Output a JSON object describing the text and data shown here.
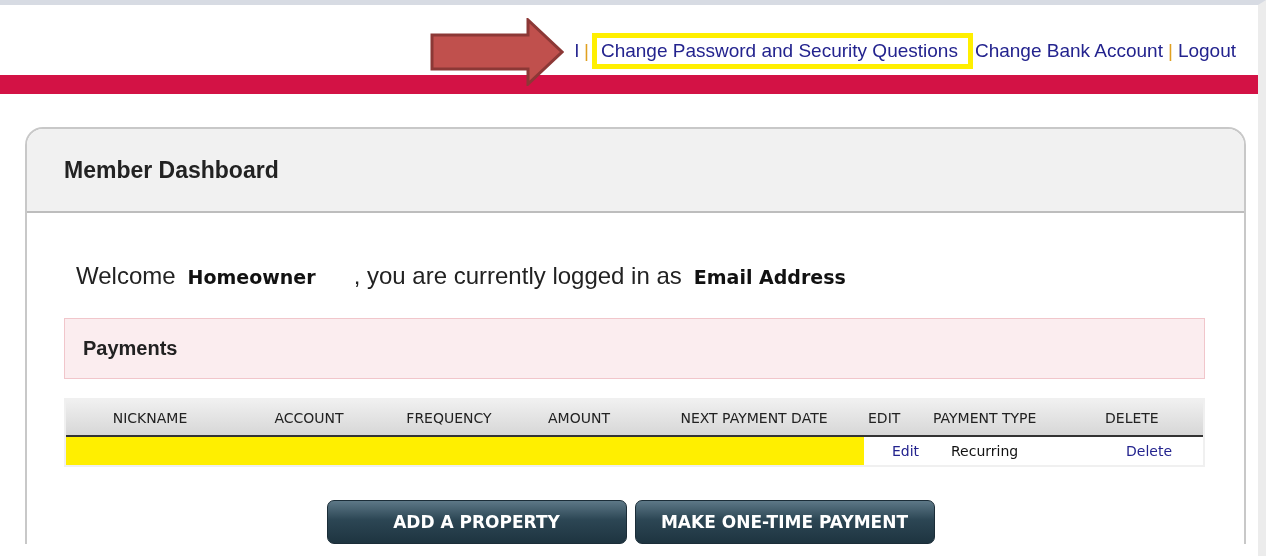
{
  "top_links": [
    {
      "kind": "link",
      "label": "l",
      "highlighted": false
    },
    {
      "kind": "separator",
      "label": "|"
    },
    {
      "kind": "link",
      "label": "Change Password and Security Questions",
      "highlighted": true
    },
    {
      "kind": "link",
      "label": "Change Bank Account",
      "highlighted": false
    },
    {
      "kind": "separator",
      "label": "|"
    },
    {
      "kind": "link",
      "label": "Logout",
      "highlighted": false
    }
  ],
  "annotation_arrow": true,
  "panel": {
    "title": "Member Dashboard",
    "welcome": {
      "prefix": "Welcome",
      "name": "Homeowner",
      "middle": ", you are currently logged in as",
      "email": "Email Address"
    },
    "section": {
      "title": "Payments"
    },
    "table": {
      "columns": [
        "NICKNAME",
        "ACCOUNT",
        "FREQUENCY",
        "AMOUNT",
        "NEXT PAYMENT DATE",
        "EDIT",
        "PAYMENT TYPE",
        "DELETE"
      ],
      "rows": [
        {
          "redacted": true,
          "edit": "Edit",
          "payment_type": "Recurring",
          "delete": "Delete"
        }
      ]
    },
    "buttons": [
      "ADD A PROPERTY",
      "MAKE ONE-TIME PAYMENT"
    ]
  }
}
